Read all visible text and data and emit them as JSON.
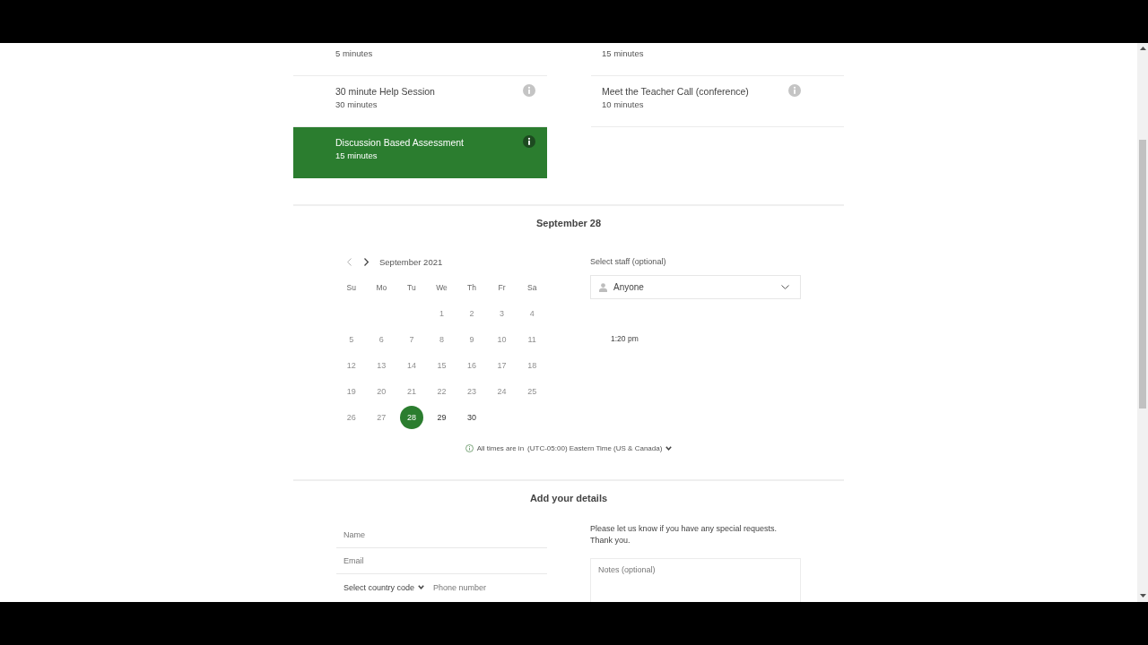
{
  "services": [
    {
      "duration": "5 minutes",
      "selected": false
    },
    {
      "duration": "15 minutes",
      "selected": false
    },
    {
      "title": "30 minute Help Session",
      "duration": "30 minutes",
      "selected": false
    },
    {
      "title": "Meet the Teacher Call (conference)",
      "duration": "10 minutes",
      "selected": false
    },
    {
      "title": "Discussion Based Assessment",
      "duration": "15 minutes",
      "selected": true
    }
  ],
  "calendar": {
    "heading": "September 28",
    "month": "September 2021",
    "prev_disabled": true,
    "next_disabled": false,
    "weekdays": [
      "Su",
      "Mo",
      "Tu",
      "We",
      "Th",
      "Fr",
      "Sa"
    ],
    "weeks": [
      [
        {
          "day": "1",
          "disabled": true,
          "selected": false
        },
        {
          "day": "2",
          "disabled": true,
          "selected": false
        },
        {
          "day": "3",
          "disabled": true,
          "selected": false
        },
        {
          "day": "4",
          "disabled": true,
          "selected": false
        }
      ],
      [
        {
          "day": "5",
          "disabled": true,
          "selected": false
        },
        {
          "day": "6",
          "disabled": true,
          "selected": false
        },
        {
          "day": "7",
          "disabled": true,
          "selected": false
        },
        {
          "day": "8",
          "disabled": true,
          "selected": false
        },
        {
          "day": "9",
          "disabled": true,
          "selected": false
        },
        {
          "day": "10",
          "disabled": true,
          "selected": false
        },
        {
          "day": "11",
          "disabled": true,
          "selected": false
        }
      ],
      [
        {
          "day": "12",
          "disabled": true,
          "selected": false
        },
        {
          "day": "13",
          "disabled": true,
          "selected": false
        },
        {
          "day": "14",
          "disabled": true,
          "selected": false
        },
        {
          "day": "15",
          "disabled": true,
          "selected": false
        },
        {
          "day": "16",
          "disabled": true,
          "selected": false
        },
        {
          "day": "17",
          "disabled": true,
          "selected": false
        },
        {
          "day": "18",
          "disabled": true,
          "selected": false
        }
      ],
      [
        {
          "day": "19",
          "disabled": true,
          "selected": false
        },
        {
          "day": "20",
          "disabled": true,
          "selected": false
        },
        {
          "day": "21",
          "disabled": true,
          "selected": false
        },
        {
          "day": "22",
          "disabled": true,
          "selected": false
        },
        {
          "day": "23",
          "disabled": true,
          "selected": false
        },
        {
          "day": "24",
          "disabled": true,
          "selected": false
        },
        {
          "day": "25",
          "disabled": true,
          "selected": false
        }
      ],
      [
        {
          "day": "26",
          "disabled": true,
          "selected": false
        },
        {
          "day": "27",
          "disabled": true,
          "selected": false
        },
        {
          "day": "28",
          "disabled": false,
          "selected": true
        },
        {
          "day": "29",
          "disabled": false,
          "selected": false
        },
        {
          "day": "30",
          "disabled": false,
          "selected": false
        }
      ]
    ]
  },
  "staff": {
    "label": "Select staff (optional)",
    "value": "Anyone"
  },
  "time_slots": [
    "1:20 pm"
  ],
  "timezone": {
    "label": "All times are in",
    "value": "(UTC-05:00) Eastern Time (US & Canada)"
  },
  "details": {
    "heading": "Add your details",
    "name": {
      "placeholder": "Name"
    },
    "email": {
      "placeholder": "Email"
    },
    "country_code": "Select country code",
    "phone": {
      "placeholder": "Phone number"
    },
    "note": "Please let us know if you have any special requests. Thank you.",
    "notes": {
      "placeholder": "Notes (optional)"
    }
  }
}
